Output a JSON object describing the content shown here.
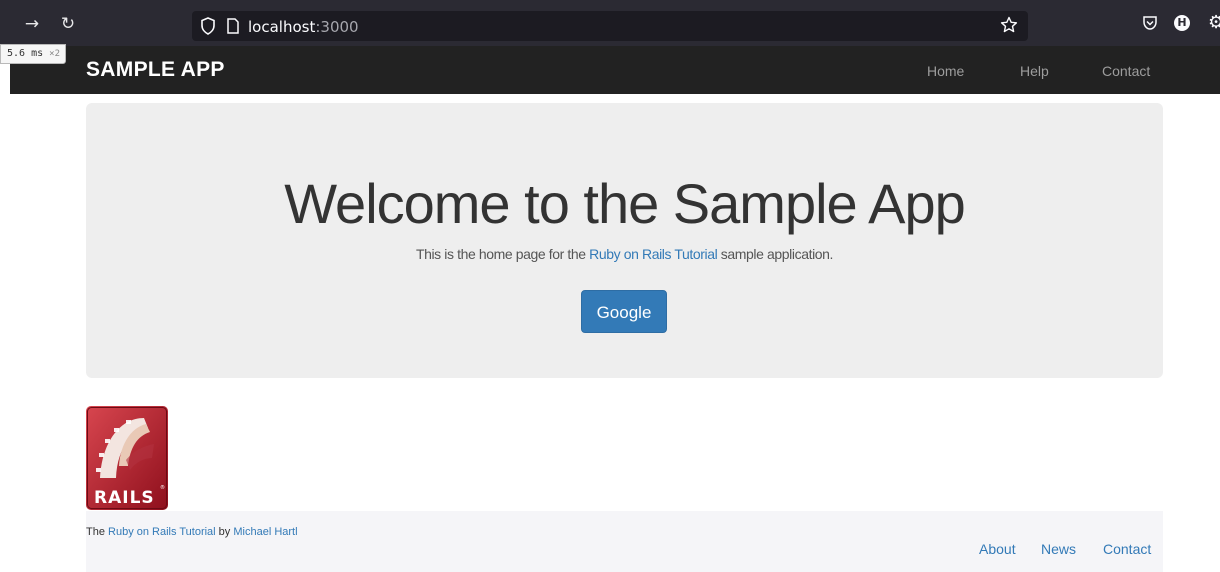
{
  "browser": {
    "url_host": "localhost",
    "url_port": ":3000"
  },
  "timing_badge": {
    "value": "5.6",
    "unit": "ms",
    "multiplier": "×2"
  },
  "navbar": {
    "logo": "SAMPLE APP",
    "links": [
      {
        "label": "Home"
      },
      {
        "label": "Help"
      },
      {
        "label": "Contact"
      }
    ]
  },
  "jumbotron": {
    "title": "Welcome to the Sample App",
    "text_before": "This is the home page for the ",
    "link": "Ruby on Rails Tutorial",
    "text_after": " sample application.",
    "button": "Google"
  },
  "rails_logo": {
    "text": "RAILS"
  },
  "footer": {
    "text_the": "The ",
    "tutorial_link": "Ruby on Rails Tutorial",
    "text_by": " by ",
    "author_link": "Michael Hartl",
    "links": [
      {
        "label": "About"
      },
      {
        "label": "News"
      },
      {
        "label": "Contact"
      }
    ]
  },
  "colors": {
    "navbar_bg": "#222222",
    "jumbotron_bg": "#eeeeee",
    "primary": "#337ab7",
    "footer_bg": "#f5f5f8"
  }
}
